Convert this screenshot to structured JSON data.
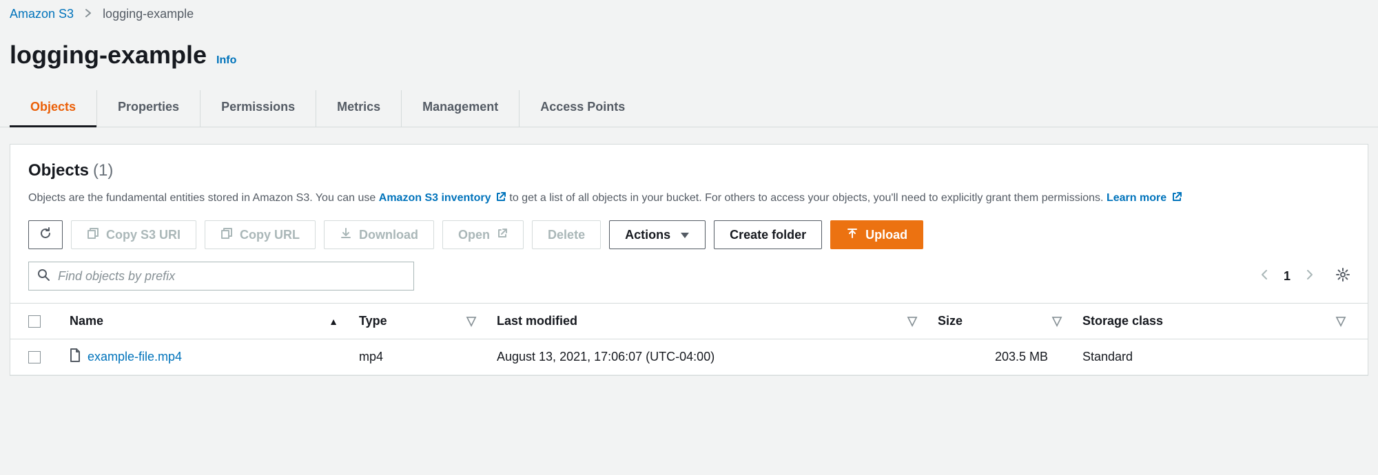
{
  "breadcrumb": {
    "service": "Amazon S3",
    "bucket": "logging-example"
  },
  "header": {
    "title": "logging-example",
    "info_label": "Info"
  },
  "tabs": [
    {
      "label": "Objects",
      "active": true
    },
    {
      "label": "Properties"
    },
    {
      "label": "Permissions"
    },
    {
      "label": "Metrics"
    },
    {
      "label": "Management"
    },
    {
      "label": "Access Points"
    }
  ],
  "panel": {
    "title": "Objects",
    "count": "(1)",
    "desc_before": "Objects are the fundamental entities stored in Amazon S3. You can use ",
    "desc_link1": "Amazon S3 inventory",
    "desc_mid": " to get a list of all objects in your bucket. For others to access your objects, you'll need to explicitly grant them permissions. ",
    "desc_link2": "Learn more"
  },
  "actions": {
    "copy_uri": "Copy S3 URI",
    "copy_url": "Copy URL",
    "download": "Download",
    "open": "Open",
    "delete": "Delete",
    "actions": "Actions",
    "create_folder": "Create folder",
    "upload": "Upload"
  },
  "search": {
    "placeholder": "Find objects by prefix"
  },
  "pagination": {
    "page": "1"
  },
  "table": {
    "headers": {
      "name": "Name",
      "type": "Type",
      "modified": "Last modified",
      "size": "Size",
      "storage": "Storage class"
    },
    "rows": [
      {
        "name": "example-file.mp4",
        "type": "mp4",
        "modified": "August 13, 2021, 17:06:07 (UTC-04:00)",
        "size": "203.5 MB",
        "storage": "Standard"
      }
    ]
  }
}
